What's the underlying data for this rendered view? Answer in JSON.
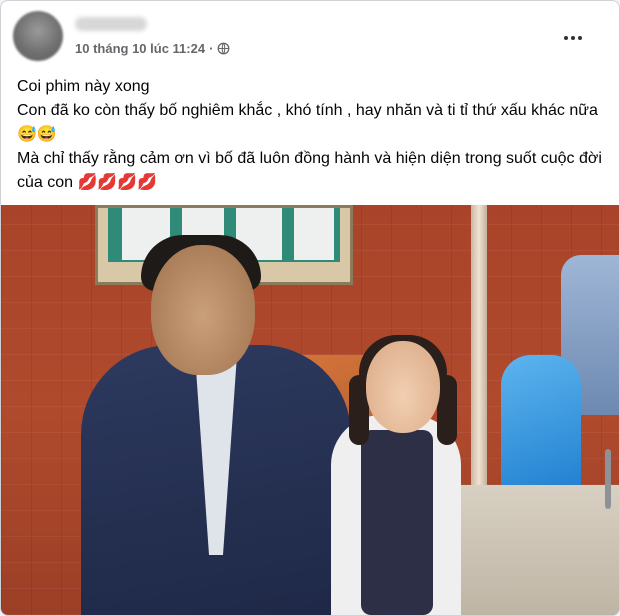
{
  "post": {
    "timestamp": "10 tháng 10 lúc 11:24",
    "separator": "·",
    "audience_icon": "globe-icon",
    "more_icon": "more-options-icon",
    "lines": [
      "Coi phim này xong",
      "Con đã ko còn thấy bố nghiêm khắc , khó tính , hay nhăn và ti tỉ thứ xấu khác nữa 😅😅",
      "Mà chỉ thấy rằng cảm ơn vì bố đã luôn đồng hành và hiện diện trong suốt cuộc đời của con 💋💋💋💋"
    ]
  },
  "colors": {
    "meta_text": "#65676b",
    "body_text": "#050505",
    "brick": "#a9442a"
  }
}
